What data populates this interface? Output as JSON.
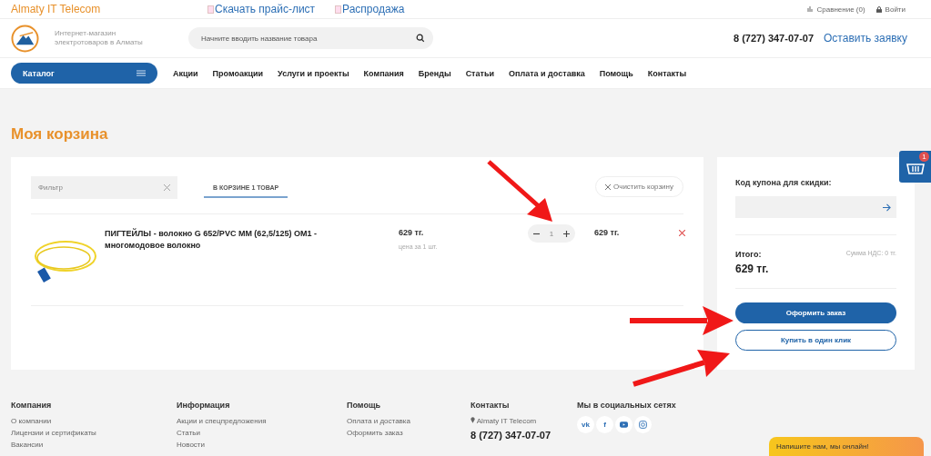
{
  "top_bar": {
    "brand": "Almaty IT Telecom",
    "links": [
      "Скачать прайс-лист",
      "Распродажа"
    ],
    "compare": "Сравнение (0)",
    "login": "Войти"
  },
  "header": {
    "tagline": "Интернет-магазин электротоваров в Алматы",
    "search": {
      "placeholder": "Начните вводить название товара"
    },
    "phone": "8 (727) 347-07-07",
    "request_link": "Оставить заявку"
  },
  "nav": {
    "catalog": "Каталог",
    "items": [
      "Акции",
      "Промоакции",
      "Услуги и проекты",
      "Компания",
      "Бренды",
      "Статьи",
      "Оплата и доставка",
      "Помощь",
      "Контакты"
    ]
  },
  "page_title": "Моя корзина",
  "cart": {
    "filter": {
      "placeholder": "Фильтр"
    },
    "tabs": [
      {
        "label": "В КОРЗИНЕ 1 ТОВАР",
        "selected": true
      }
    ],
    "clear_button": "Очистить корзину",
    "items": [
      {
        "name": "ПИГТЕЙЛЫ - волокно G 652/PVC MM (62,5/125) OM1 - многомодовое волокно",
        "price": "629 тг.",
        "unit_note": "цена за 1 шт.",
        "quantity": "1",
        "total": "629 тг."
      }
    ]
  },
  "summary": {
    "coupon_label": "Код купона для скидки:",
    "total_label": "Итого:",
    "total": "629 тг.",
    "vat": "Сумма НДС: 0 тг.",
    "order_button": "Оформить заказ",
    "one_click_button": "Купить в один клик"
  },
  "floating_cart": {
    "count": "1"
  },
  "footer": {
    "columns": [
      {
        "title": "Компания",
        "links": [
          "О компании",
          "Лицензии и сертификаты",
          "Вакансии"
        ]
      },
      {
        "title": "Информация",
        "links": [
          "Акции и спецпредложения",
          "Статьи",
          "Новости"
        ]
      },
      {
        "title": "Помощь",
        "links": [
          "Оплата и доставка",
          "Оформить заказ"
        ]
      }
    ],
    "contacts": {
      "title": "Контакты",
      "company": "Almaty IT Telecom",
      "phone": "8 (727) 347-07-07"
    },
    "social": {
      "title": "Мы в социальных сетях",
      "networks": [
        {
          "kind": "vk",
          "label": "vk"
        },
        {
          "kind": "facebook",
          "label": "f"
        },
        {
          "kind": "youtube"
        },
        {
          "kind": "instagram"
        }
      ]
    }
  },
  "chat_widget": "Напишите нам, мы онлайн!"
}
